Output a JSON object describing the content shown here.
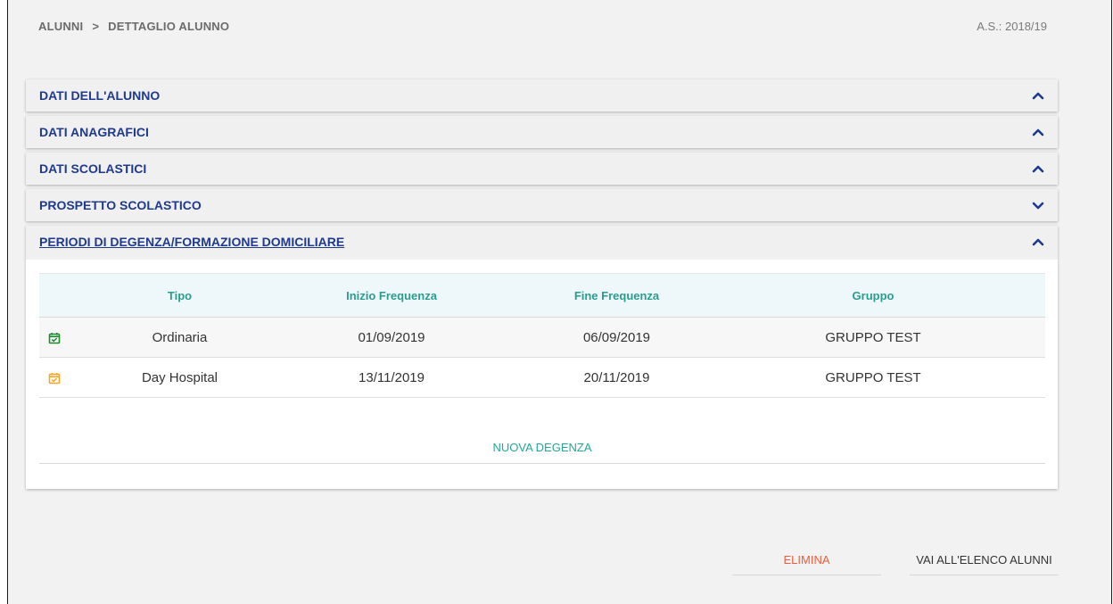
{
  "breadcrumb": {
    "root": "ALUNNI",
    "separator": ">",
    "current": "DETTAGLIO ALUNNO"
  },
  "school_year": "A.S.: 2018/19",
  "panels": [
    {
      "title": "DATI DELL'ALUNNO",
      "state": "expanded",
      "chevron": "chevron-up-icon"
    },
    {
      "title": "DATI ANAGRAFICI",
      "state": "expanded",
      "chevron": "chevron-up-icon"
    },
    {
      "title": "DATI SCOLASTICI",
      "state": "expanded",
      "chevron": "chevron-up-icon"
    },
    {
      "title": "PROSPETTO SCOLASTICO",
      "state": "collapsed",
      "chevron": "chevron-down-icon"
    },
    {
      "title": "PERIODI DI DEGENZA/FORMAZIONE DOMICILIARE",
      "state": "expanded",
      "chevron": "chevron-up-icon"
    }
  ],
  "degenze_table": {
    "headers": [
      "",
      "Tipo",
      "Inizio Frequenza",
      "Fine Frequenza",
      "Gruppo"
    ],
    "rows": [
      {
        "icon": "calendar-check-icon",
        "icon_color": "#1e8a2e",
        "tipo": "Ordinaria",
        "inizio": "01/09/2019",
        "fine": "06/09/2019",
        "gruppo": "GRUPPO TEST"
      },
      {
        "icon": "calendar-check-icon",
        "icon_color": "#f5a623",
        "tipo": "Day Hospital",
        "inizio": "13/11/2019",
        "fine": "20/11/2019",
        "gruppo": "GRUPPO TEST"
      }
    ],
    "new_label": "NUOVA DEGENZA"
  },
  "actions": {
    "delete_label": "ELIMINA",
    "back_label": "VAI ALL'ELENCO ALUNNI"
  },
  "colors": {
    "panel_title": "#1f3a8c",
    "table_header": "#2a9d8f",
    "new_link": "#26a69a",
    "delete": "#f25c3b"
  }
}
